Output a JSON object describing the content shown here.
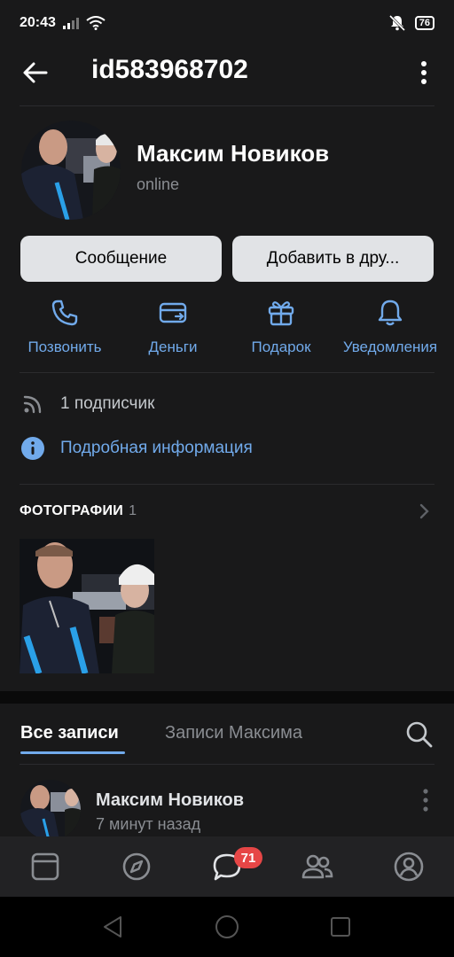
{
  "status": {
    "time": "20:43",
    "battery": "76"
  },
  "header": {
    "title": "id583968702"
  },
  "profile": {
    "name": "Максим Новиков",
    "status": "online"
  },
  "buttons": {
    "message": "Сообщение",
    "add_friend": "Добавить в дру..."
  },
  "actions": [
    {
      "label": "Позвонить",
      "icon": "phone-icon"
    },
    {
      "label": "Деньги",
      "icon": "money-icon"
    },
    {
      "label": "Подарок",
      "icon": "gift-icon"
    },
    {
      "label": "Уведомления",
      "icon": "bell-icon"
    }
  ],
  "info": {
    "subscribers": "1 подписчик",
    "details": "Подробная информация"
  },
  "photos": {
    "header": "ФОТОГРАФИИ",
    "count": "1"
  },
  "tabs": {
    "all": "Все записи",
    "own": "Записи Максима"
  },
  "post": {
    "author": "Максим Новиков",
    "time": "7 минут назад"
  },
  "nav": {
    "messages_badge": "71"
  },
  "colors": {
    "accent": "#71aaeb",
    "background": "#19191a",
    "badge": "#e64646"
  }
}
